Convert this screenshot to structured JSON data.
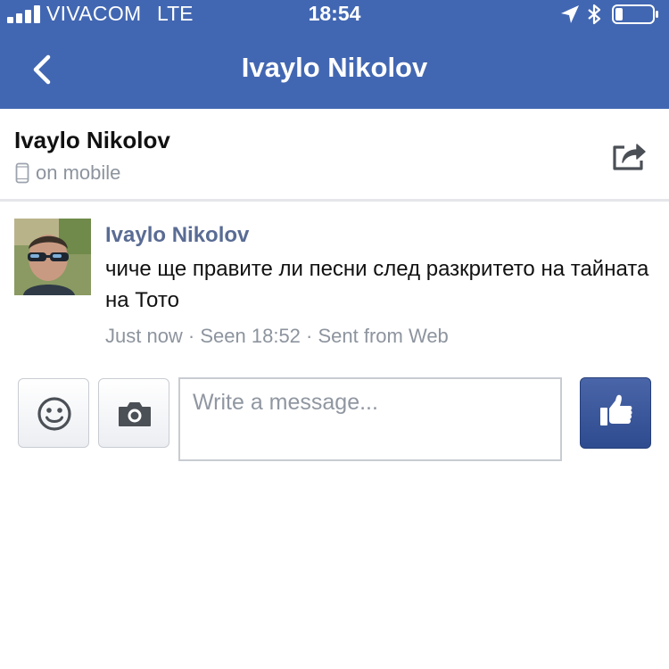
{
  "status_bar": {
    "carrier": "VIVACOM",
    "network": "LTE",
    "time": "18:54",
    "signal_bars": 4,
    "battery_level": 0.2,
    "icons": [
      "signal-icon",
      "location-arrow-icon",
      "bluetooth-icon",
      "battery-icon"
    ]
  },
  "nav": {
    "title": "Ivaylo Nikolov",
    "back_icon": "chevron-left-icon"
  },
  "contact": {
    "name": "Ivaylo Nikolov",
    "presence": "on mobile",
    "presence_icon": "mobile-phone-icon",
    "share_icon": "share-icon"
  },
  "message": {
    "sender": "Ivaylo Nikolov",
    "text": "чиче ще правите ли песни след разкритето на тайната на Тото",
    "meta": "Just now · Seen 18:52 · Sent from Web"
  },
  "composer": {
    "placeholder": "Write a message...",
    "emoji_icon": "smiley-icon",
    "camera_icon": "camera-icon",
    "like_icon": "thumbs-up-icon"
  },
  "colors": {
    "header_blue": "#4267b2",
    "sender_name": "#5a6c94",
    "meta_gray": "#8d949e",
    "like_button": "#3b5998"
  }
}
